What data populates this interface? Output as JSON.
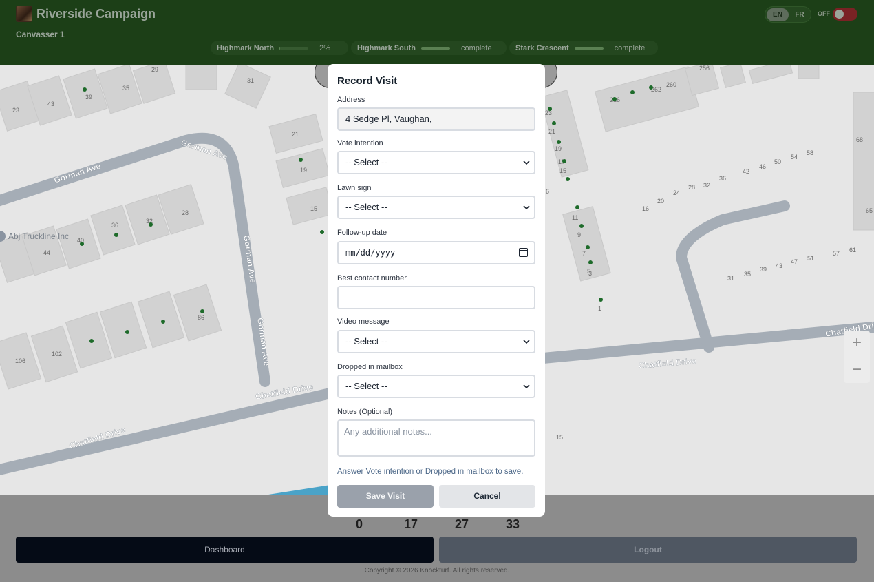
{
  "header": {
    "title": "Riverside Campaign",
    "user": "Canvasser 1",
    "lang_en": "EN",
    "lang_fr": "FR",
    "toggle_label": "OFF",
    "toggle_on": false,
    "territories": [
      {
        "name": "Highmark North",
        "status": "2%",
        "progress": 0.02
      },
      {
        "name": "Highmark South",
        "status": "complete",
        "progress": 1.0
      },
      {
        "name": "Stark Crescent",
        "status": "complete",
        "progress": 1.0
      }
    ]
  },
  "map": {
    "streets": [
      "Gorman Ave",
      "Gorman Ave",
      "Gorman Ave",
      "Gorman Ave",
      "Chatfield Drive",
      "Chatfield Drive",
      "Chatfield Drive",
      "Chatfield Drive"
    ],
    "poi": "Abj Truckline Inc",
    "house_numbers": [
      "29",
      "31",
      "23",
      "43",
      "39",
      "35",
      "21",
      "19",
      "15",
      "36",
      "32",
      "28",
      "40",
      "44",
      "86",
      "106",
      "102",
      "256",
      "262",
      "260",
      "216",
      "23",
      "21",
      "19",
      "17",
      "15",
      "68",
      "16",
      "20",
      "24",
      "28",
      "32",
      "36",
      "42",
      "46",
      "50",
      "54",
      "58",
      "65",
      "11",
      "9",
      "7",
      "5",
      "3",
      "1",
      "31",
      "35",
      "39",
      "43",
      "47",
      "51",
      "57",
      "61",
      "15",
      "6"
    ],
    "zoom_in": "+",
    "zoom_out": "−"
  },
  "modal": {
    "title": "Record Visit",
    "address_label": "Address",
    "address_value": "4 Sedge         Pl, Vaughan,",
    "vote_label": "Vote intention",
    "vote_value": "-- Select --",
    "lawn_label": "Lawn sign",
    "lawn_value": "-- Select --",
    "followup_label": "Follow-up date",
    "followup_placeholder": "mm/dd/yyyy",
    "phone_label": "Best contact number",
    "phone_value": "",
    "video_label": "Video message",
    "video_value": "-- Select --",
    "mailbox_label": "Dropped in mailbox",
    "mailbox_value": "-- Select --",
    "notes_label": "Notes (Optional)",
    "notes_placeholder": "Any additional notes...",
    "hint": "Answer Vote intention or Dropped in mailbox to save.",
    "save_label": "Save Visit",
    "cancel_label": "Cancel"
  },
  "stats": [
    "0",
    "17",
    "27",
    "33"
  ],
  "footer": {
    "dashboard_label": "Dashboard",
    "logout_label": "Logout",
    "copyright": "Copyright © 2026 Knockturf. All rights reserved."
  },
  "colors": {
    "header_bg": "#1c3f17",
    "dashboard_bg": "#050b16",
    "logout_bg": "#4f5762",
    "save_disabled": "#9aa1ab",
    "toggle_off": "#7a2224"
  }
}
